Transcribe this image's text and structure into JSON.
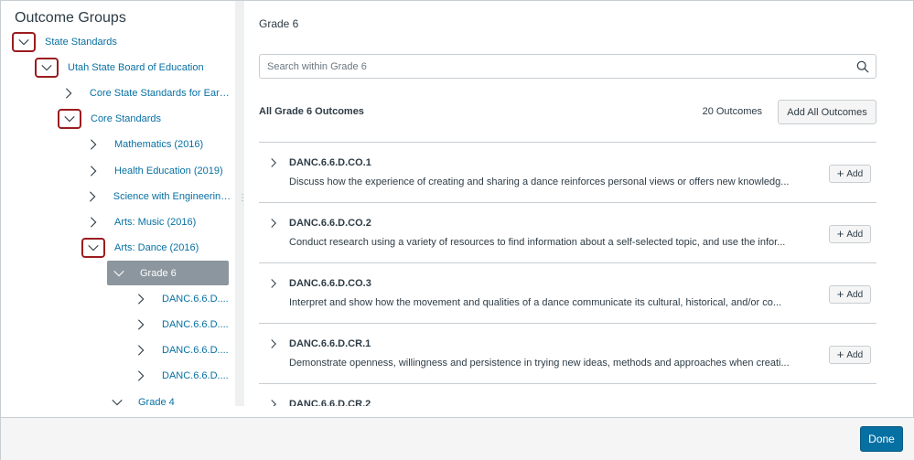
{
  "sidebar": {
    "title": "Outcome Groups",
    "items": [
      {
        "label": "State Standards",
        "expanded": true
      },
      {
        "label": "Utah State Board of Education",
        "expanded": true
      },
      {
        "label": "Core State Standards for Early ...",
        "expanded": false
      },
      {
        "label": "Core Standards",
        "expanded": true
      },
      {
        "label": "Mathematics (2016)",
        "expanded": false
      },
      {
        "label": "Health Education (2019)",
        "expanded": false
      },
      {
        "label": "Science with Engineering ...",
        "expanded": false
      },
      {
        "label": "Arts: Music (2016)",
        "expanded": false
      },
      {
        "label": "Arts: Dance (2016)",
        "expanded": true
      },
      {
        "label": "Grade 6",
        "expanded": true,
        "selected": true
      },
      {
        "label": "DANC.6.6.D....",
        "expanded": false
      },
      {
        "label": "DANC.6.6.D....",
        "expanded": false
      },
      {
        "label": "DANC.6.6.D....",
        "expanded": false
      },
      {
        "label": "DANC.6.6.D....",
        "expanded": false
      },
      {
        "label": "Grade 4",
        "expanded": false
      }
    ]
  },
  "main": {
    "title": "Grade 6",
    "search": {
      "placeholder": "Search within Grade 6",
      "value": ""
    },
    "list_title": "All Grade 6 Outcomes",
    "count": "20 Outcomes",
    "add_all_label": "Add All Outcomes",
    "add_label": "Add",
    "outcomes": [
      {
        "code": "DANC.6.6.D.CO.1",
        "description": "Discuss how the experience of creating and sharing a dance reinforces personal views or offers new knowledg..."
      },
      {
        "code": "DANC.6.6.D.CO.2",
        "description": "Conduct research using a variety of resources to find information about a self-selected topic, and use the infor..."
      },
      {
        "code": "DANC.6.6.D.CO.3",
        "description": "Interpret and show how the movement and qualities of a dance communicate its cultural, historical, and/or co..."
      },
      {
        "code": "DANC.6.6.D.CR.1",
        "description": "Demonstrate openness, willingness and persistence in trying new ideas, methods and approaches when creati..."
      },
      {
        "code": "DANC.6.6.D.CR.2",
        "description": ""
      }
    ]
  },
  "footer": {
    "done_label": "Done"
  },
  "colors": {
    "link": "#0770a3",
    "selected_bg": "#8b969e",
    "highlight_border": "#9b1c20",
    "primary_button": "#0770a3"
  }
}
